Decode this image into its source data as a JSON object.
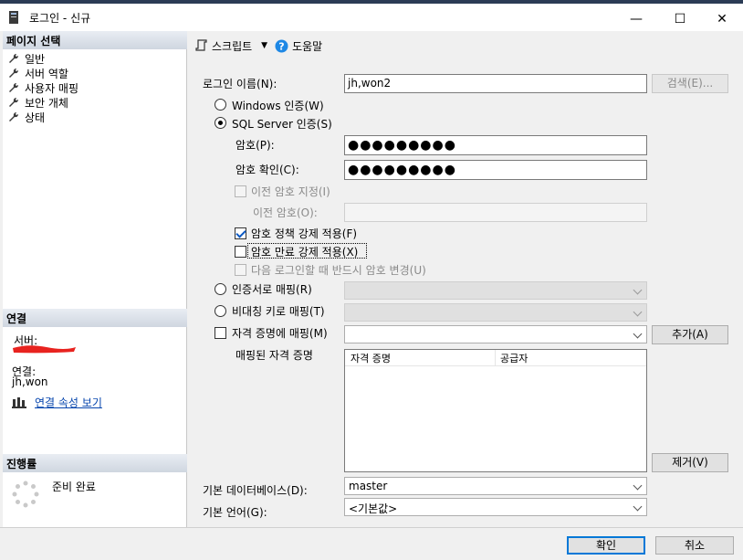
{
  "window": {
    "title": "로그인 - 신규",
    "minimize": "—",
    "maximize": "☐",
    "close": "✕"
  },
  "left": {
    "page_select_header": "페이지 선택",
    "pages": [
      {
        "label": "일반"
      },
      {
        "label": "서버 역할"
      },
      {
        "label": "사용자 매핑"
      },
      {
        "label": "보안 개체"
      },
      {
        "label": "상태"
      }
    ],
    "connection_header": "연결",
    "server_label": "서버:",
    "connection_label": "연결:",
    "connection_value": "jh,won",
    "view_props_link": "연결 속성 보기",
    "progress_header": "진행률",
    "progress_status": "준비 완료"
  },
  "toolbar": {
    "script_label": "스크립트",
    "help_label": "도움말"
  },
  "form": {
    "login_name_label": "로그인 이름(N):",
    "login_name_value": "jh,won2",
    "search_button": "검색(E)...",
    "windows_auth": "Windows 인증(W)",
    "sql_auth": "SQL Server 인증(S)",
    "password_label": "암호(P):",
    "password_value": "●●●●●●●●●",
    "confirm_label": "암호 확인(C):",
    "confirm_value": "●●●●●●●●●",
    "old_password_check": "이전 암호 지정(I)",
    "old_password_label": "이전 암호(O):",
    "enforce_policy": "암호 정책 강제 적용(F)",
    "enforce_expiration": "암호 만료 강제 적용(X)",
    "must_change": "다음 로그인할 때 반드시 암호 변경(U)",
    "cert_mapping": "인증서로 매핑(R)",
    "asym_key_mapping": "비대칭 키로 매핑(T)",
    "cred_mapping": "자격 증명에 매핑(M)",
    "add_button": "추가(A)",
    "mapped_creds_label": "매핑된 자격 증명",
    "cred_col_credential": "자격 증명",
    "cred_col_provider": "공급자",
    "remove_button": "제거(V)",
    "default_db_label": "기본 데이터베이스(D):",
    "default_db_value": "master",
    "default_lang_label": "기본 언어(G):",
    "default_lang_value": "<기본값>"
  },
  "footer": {
    "ok_button": "확인",
    "cancel_button": "취소"
  },
  "colors": {
    "accent": "#0078d7",
    "link": "#0645ad",
    "redaction": "#e8231f"
  }
}
